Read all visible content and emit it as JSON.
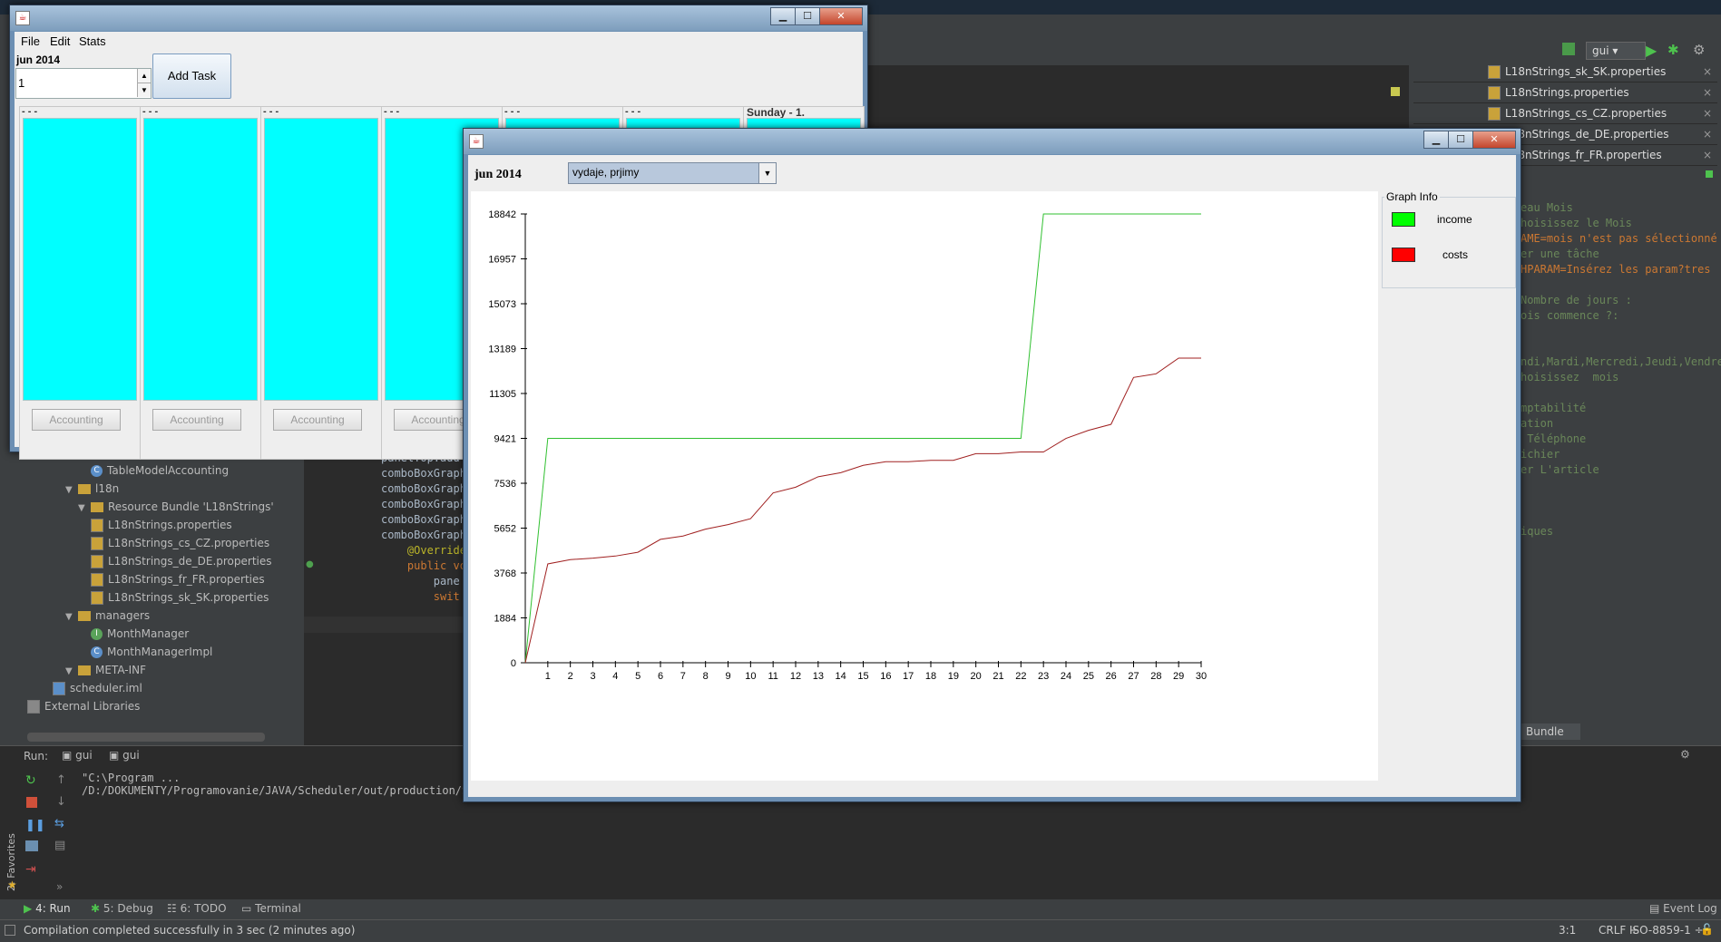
{
  "ide": {
    "project_tree": [
      {
        "label": "TableModelAccounting",
        "kind": "class",
        "depth": 4
      },
      {
        "label": "l18n",
        "kind": "folder",
        "depth": 2
      },
      {
        "label": "Resource Bundle 'L18nStrings'",
        "kind": "bundle",
        "depth": 3
      },
      {
        "label": "L18nStrings.properties",
        "kind": "file",
        "depth": 4
      },
      {
        "label": "L18nStrings_cs_CZ.properties",
        "kind": "file",
        "depth": 4
      },
      {
        "label": "L18nStrings_de_DE.properties",
        "kind": "file",
        "depth": 4
      },
      {
        "label": "L18nStrings_fr_FR.properties",
        "kind": "file",
        "depth": 4
      },
      {
        "label": "L18nStrings_sk_SK.properties",
        "kind": "file",
        "depth": 4
      },
      {
        "label": "managers",
        "kind": "folder",
        "depth": 2
      },
      {
        "label": "MonthManager",
        "kind": "interface",
        "depth": 4
      },
      {
        "label": "MonthManagerImpl",
        "kind": "class",
        "depth": 4
      },
      {
        "label": "META-INF",
        "kind": "folder",
        "depth": 2
      },
      {
        "label": "scheduler.iml",
        "kind": "iml",
        "depth": 1
      },
      {
        "label": "External Libraries",
        "kind": "libs",
        "depth": 0
      }
    ],
    "code_lines": [
      "panelTop.add",
      "comboBoxGraph",
      "comboBoxGraph",
      "comboBoxGraph",
      "comboBoxGraph",
      "comboBoxGraph",
      "    @Override",
      "    public vo",
      "        pane",
      "        swit"
    ],
    "right_tabs": [
      "L18nStrings_sk_SK.properties",
      "L18nStrings.properties",
      "L18nStrings_cs_CZ.properties",
      "L18nStrings_de_DE.properties",
      "L18nStrings_fr_FR.properties"
    ],
    "props_text": [
      "eau Mois",
      "hoisissez le Mois",
      "AME=mois n'est pas sélectionné",
      "er une tâche",
      "HPARAM=Insérez les param?tres",
      "",
      "Nombre de jours :",
      "ois commence ?:",
      "",
      "",
      "ndi,Mardi,Mercredi,Jeudi,Vendredi",
      "hoisissez  mois",
      "",
      "mptabilité",
      "ation",
      " Téléphone",
      "ichier",
      "er L'article",
      "",
      "",
      "",
      "iques"
    ],
    "bundle_tab": "Bundle",
    "run_label": "Run:",
    "run_tabs": [
      "gui",
      "gui"
    ],
    "run_output": [
      "\"C:\\Program ...",
      "/D:/DOKUMENTY/Programovanie/JAVA/Scheduler/out/production/Sc"
    ],
    "favorites": "2: Favorites",
    "toolbar_config": "gui",
    "bottom_tabs": [
      "4: Run",
      "5: Debug",
      "6: TODO",
      "Terminal"
    ],
    "event_log": "Event Log",
    "status_message": "Compilation completed successfully in 3 sec (2 minutes ago)",
    "status_right": [
      "3:1",
      "CRLF ÷",
      "ISO-8859-1 ÷"
    ]
  },
  "scheduler": {
    "menu": [
      "File",
      "Edit",
      "Stats"
    ],
    "month_label": "jun 2014",
    "day_value": "1",
    "add_task": "Add Task",
    "columns": [
      {
        "header": "- - -",
        "button": "Accounting"
      },
      {
        "header": "- - -",
        "button": "Accounting"
      },
      {
        "header": "- - -",
        "button": "Accounting"
      },
      {
        "header": "- - -",
        "button": "Accounting"
      },
      {
        "header": "- - -",
        "button": ""
      },
      {
        "header": "- - -",
        "button": ""
      },
      {
        "header": "Sunday - 1.",
        "button": ""
      }
    ]
  },
  "graph_window": {
    "month_label": "jun 2014",
    "combo_value": "vydaje, prjimy",
    "legend_title": "Graph Info",
    "legend": [
      {
        "name": "income",
        "color": "#00ff00"
      },
      {
        "name": "costs",
        "color": "#ff0000"
      }
    ]
  },
  "chart_data": {
    "type": "line",
    "title": "",
    "xlabel": "",
    "ylabel": "",
    "x": [
      0,
      1,
      2,
      3,
      4,
      5,
      6,
      7,
      8,
      9,
      10,
      11,
      12,
      13,
      14,
      15,
      16,
      17,
      18,
      19,
      20,
      21,
      22,
      23,
      24,
      25,
      26,
      27,
      28,
      29,
      30
    ],
    "xticks": [
      1,
      2,
      3,
      4,
      5,
      6,
      7,
      8,
      9,
      10,
      11,
      12,
      13,
      14,
      15,
      16,
      17,
      18,
      19,
      20,
      21,
      22,
      23,
      24,
      25,
      26,
      27,
      28,
      29,
      30
    ],
    "yticks": [
      0,
      1884,
      3768,
      5652,
      7536,
      9421,
      11305,
      13189,
      15073,
      16957,
      18842
    ],
    "ylim": [
      0,
      18842
    ],
    "xlim": [
      0,
      30
    ],
    "series": [
      {
        "name": "income",
        "color": "#30c030",
        "values": [
          0,
          9421,
          9421,
          9421,
          9421,
          9421,
          9421,
          9421,
          9421,
          9421,
          9421,
          9421,
          9421,
          9421,
          9421,
          9421,
          9421,
          9421,
          9421,
          9421,
          9421,
          9421,
          9421,
          18842,
          18842,
          18842,
          18842,
          18842,
          18842,
          18842,
          18842
        ]
      },
      {
        "name": "costs",
        "color": "#a02020",
        "values": [
          0,
          4150,
          4330,
          4390,
          4480,
          4640,
          5180,
          5320,
          5610,
          5800,
          6050,
          7130,
          7370,
          7810,
          7980,
          8290,
          8440,
          8440,
          8500,
          8500,
          8780,
          8780,
          8850,
          8850,
          9420,
          9760,
          10010,
          11980,
          12130,
          12790,
          12790
        ]
      }
    ]
  }
}
